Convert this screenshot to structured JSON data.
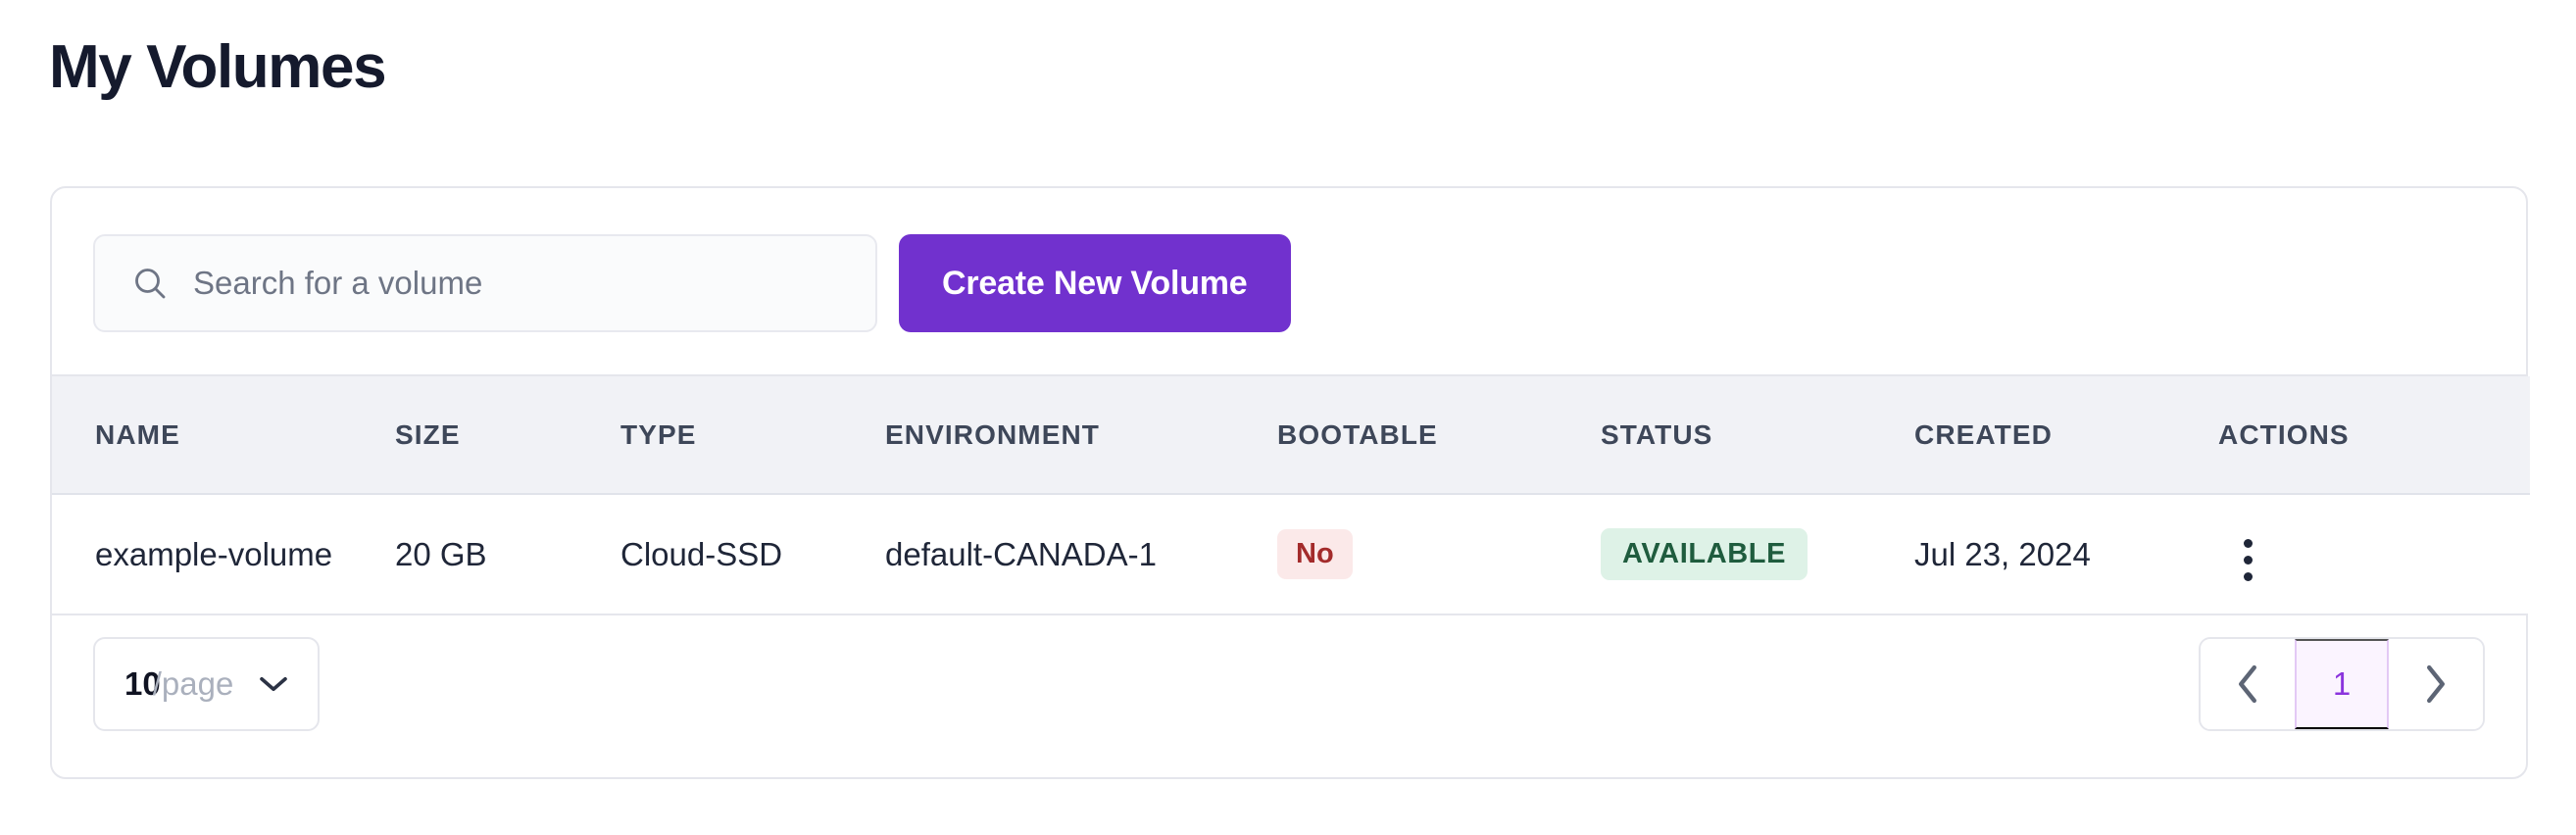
{
  "header": {
    "title": "My Volumes"
  },
  "toolbar": {
    "search_placeholder": "Search for a volume",
    "search_value": "",
    "search_icon": "search-icon",
    "create_button_label": "Create New Volume"
  },
  "table": {
    "columns": [
      "NAME",
      "SIZE",
      "TYPE",
      "ENVIRONMENT",
      "BOOTABLE",
      "STATUS",
      "CREATED",
      "ACTIONS"
    ],
    "rows": [
      {
        "name": "example-volume",
        "size": "20 GB",
        "type": "Cloud-SSD",
        "environment": "default-CANADA-1",
        "bootable": "No",
        "status": "AVAILABLE",
        "created": "Jul 23, 2024",
        "actions_icon": "kebab-menu-icon"
      }
    ]
  },
  "pagination": {
    "page_size_count": "10",
    "page_size_label": "/page",
    "page_size_chevron_icon": "chevron-down-icon",
    "prev_icon": "chevron-left-icon",
    "next_icon": "chevron-right-icon",
    "current_page": "1"
  },
  "colors": {
    "accent_purple": "#7131ce",
    "title_text": "#151a2d",
    "header_row_bg": "#f1f2f6",
    "header_text": "#3e4759",
    "badge_no_bg": "#fbe9e9",
    "badge_no_text": "#a32b2b",
    "badge_available_bg": "#def2e7",
    "badge_available_text": "#1f5c3e",
    "pager_active_bg": "#fbf4ff",
    "pager_active_text": "#8b34dd",
    "card_border": "#e5e6ec"
  }
}
